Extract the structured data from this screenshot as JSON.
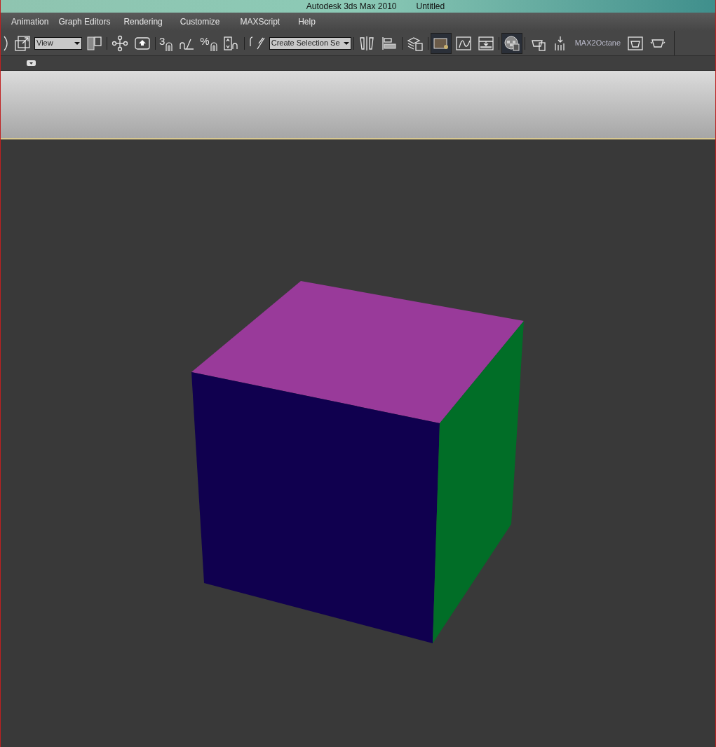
{
  "window": {
    "title": "Autodesk 3ds Max  2010",
    "document": "Untitled"
  },
  "menu": [
    "Animation",
    "Graph Editors",
    "Rendering",
    "Customize",
    "MAXScript",
    "Help"
  ],
  "toolbar": [
    {
      "kind": "icon",
      "pressed": false
    },
    {
      "kind": "icon",
      "pressed": false
    },
    {
      "kind": "dropdown",
      "value": "View"
    },
    {
      "kind": "icon",
      "pressed": false
    },
    {
      "kind": "separator"
    },
    {
      "kind": "icon",
      "pressed": false
    },
    {
      "kind": "icon",
      "pressed": false
    },
    {
      "kind": "separator"
    },
    {
      "kind": "snap",
      "label": "3"
    },
    {
      "kind": "icon",
      "pressed": false
    },
    {
      "kind": "snap",
      "label": "%"
    },
    {
      "kind": "icon",
      "pressed": false
    },
    {
      "kind": "separator"
    },
    {
      "kind": "icon",
      "pressed": false
    },
    {
      "kind": "dropdown",
      "value": "Create Selection Se"
    },
    {
      "kind": "separator"
    },
    {
      "kind": "icon",
      "pressed": false
    },
    {
      "kind": "icon",
      "pressed": false
    },
    {
      "kind": "separator"
    },
    {
      "kind": "icon",
      "pressed": false
    },
    {
      "kind": "separator"
    },
    {
      "kind": "icon",
      "pressed": true
    },
    {
      "kind": "icon",
      "pressed": false
    },
    {
      "kind": "icon",
      "pressed": false
    },
    {
      "kind": "separator"
    },
    {
      "kind": "icon",
      "pressed": true
    },
    {
      "kind": "separator"
    },
    {
      "kind": "icon",
      "pressed": false
    },
    {
      "kind": "icon",
      "pressed": false
    },
    {
      "kind": "text",
      "label": "MAX2Octane"
    },
    {
      "kind": "icon",
      "pressed": false
    },
    {
      "kind": "icon",
      "pressed": false
    }
  ]
}
